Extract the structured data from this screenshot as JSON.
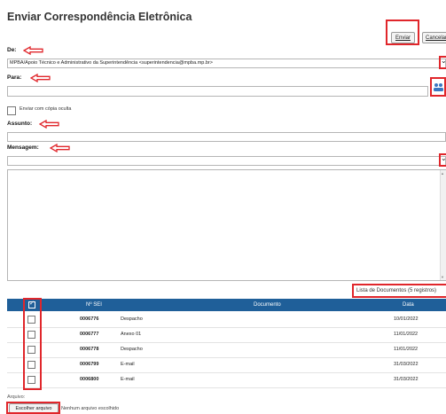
{
  "page": {
    "title": "Enviar Correspondência Eletrônica"
  },
  "buttons": {
    "send": "Enviar",
    "cancel": "Cancelar"
  },
  "form": {
    "from_label": "De:",
    "from_value": "MPBA/Apoio Técnico e Administrativo da Superintendência <superintendencia@mpba.mp.br>",
    "to_label": "Para:",
    "to_value": "",
    "bcc_label": "Enviar com cópia oculta",
    "subject_label": "Assunto:",
    "subject_value": "",
    "message_label": "Mensagem:",
    "message_select_value": "",
    "message_body": ""
  },
  "documents": {
    "caption": "Lista de Documentos (5 registros)",
    "columns": [
      "Nº SEI",
      "Documento",
      "Data"
    ],
    "rows": [
      {
        "sei": "0006776",
        "doc": "Despacho",
        "date": "10/01/2022"
      },
      {
        "sei": "0006777",
        "doc": "Anexo 01",
        "date": "11/01/2022"
      },
      {
        "sei": "0006778",
        "doc": "Despacho",
        "date": "11/01/2022"
      },
      {
        "sei": "0006799",
        "doc": "E-mail",
        "date": "31/03/2022"
      },
      {
        "sei": "0006800",
        "doc": "E-mail",
        "date": "31/03/2022"
      }
    ]
  },
  "attachment": {
    "label": "Arquivo:",
    "choose_button": "Escolher arquivo",
    "status": "Nenhum arquivo escolhido"
  },
  "colors": {
    "annotation": "#e0262b",
    "table_header": "#1f5f99"
  }
}
